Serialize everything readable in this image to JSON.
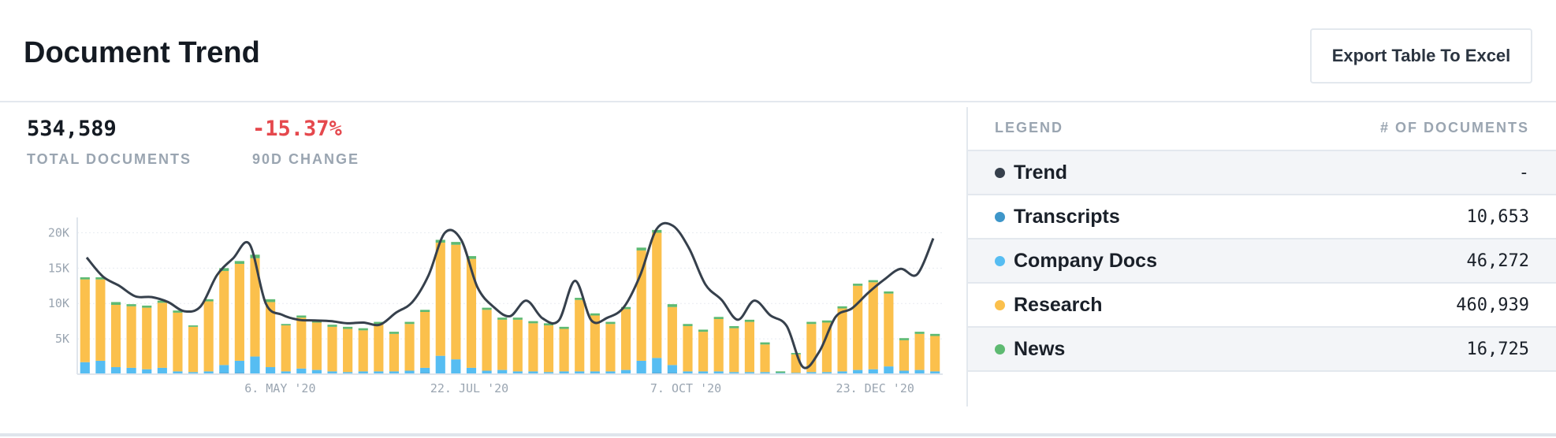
{
  "header": {
    "title": "Document Trend",
    "export_label": "Export Table To Excel"
  },
  "stats": {
    "total_value": "534,589",
    "total_label": "TOTAL DOCUMENTS",
    "change_value": "-15.37%",
    "change_label": "90D CHANGE"
  },
  "colors": {
    "trend": "#36404c",
    "transcripts": "#3e96c9",
    "company_docs": "#56bdf2",
    "research": "#fbc04c",
    "news": "#5eba72",
    "change_negative": "#e5484d"
  },
  "legend": {
    "header_left": "LEGEND",
    "header_right": "# OF DOCUMENTS",
    "rows": [
      {
        "name": "Trend",
        "count": "-"
      },
      {
        "name": "Transcripts",
        "count": "10,653"
      },
      {
        "name": "Company Docs",
        "count": "46,272"
      },
      {
        "name": "Research",
        "count": "460,939"
      },
      {
        "name": "News",
        "count": "16,725"
      }
    ]
  },
  "chart_data": {
    "type": "bar",
    "stacked": true,
    "yticks": [
      "20K",
      "15K",
      "10K",
      "5K"
    ],
    "ytick_values": [
      20000,
      15000,
      10000,
      5000
    ],
    "ylim": [
      0,
      21500
    ],
    "xtick_labels": [
      "6. MAY '20",
      "22. JUL '20",
      "7. OCT '20",
      "23. DEC '20"
    ],
    "xtick_index": [
      7.5,
      14.5,
      22.5,
      29.5
    ],
    "grid": true,
    "series": [
      {
        "name": "Transcripts",
        "values": [
          0,
          0,
          0,
          0,
          0,
          0,
          0,
          0,
          0,
          200,
          200,
          0,
          0,
          0,
          0,
          0,
          0,
          0,
          0,
          0,
          0,
          0,
          200,
          0,
          0,
          0,
          0,
          0,
          0,
          0,
          0,
          0,
          0,
          0,
          0,
          0,
          0,
          200,
          200,
          0,
          0,
          0,
          0,
          0,
          0,
          0,
          0,
          0,
          0,
          0,
          0,
          0,
          0,
          0,
          0,
          0,
          0,
          0,
          0,
          0,
          0,
          0,
          0,
          0,
          0,
          0,
          0,
          0,
          0,
          0
        ]
      },
      {
        "name": "Company Docs",
        "values": [
          1700,
          1900,
          1000,
          900,
          700,
          900,
          400,
          300,
          400,
          1100,
          1700,
          2500,
          1000,
          400,
          800,
          600,
          400,
          300,
          400,
          400,
          400,
          500,
          700,
          2600,
          2100,
          900,
          500,
          600,
          400,
          400,
          300,
          400,
          400,
          400,
          400,
          600,
          1900,
          2100,
          1100,
          400,
          400,
          400,
          300,
          300,
          300,
          200,
          200,
          300,
          300,
          400,
          600,
          700,
          1100,
          500,
          600,
          400
        ]
      },
      {
        "name": "Research",
        "values": [
          11700,
          11500,
          8800,
          8700,
          8700,
          9200,
          8300,
          6400,
          9900,
          13300,
          13700,
          13900,
          9200,
          6500,
          7200,
          6700,
          6300,
          6100,
          5800,
          6600,
          5300,
          6600,
          7900,
          16000,
          16200,
          15400,
          8600,
          7100,
          7300,
          6800,
          6600,
          6000,
          10100,
          7900,
          6700,
          8600,
          15600,
          17700,
          8200,
          6400,
          5600,
          7400,
          6200,
          7100,
          3900,
          0,
          2600,
          6800,
          7000,
          8900,
          11900,
          12300,
          10300,
          4300,
          5100,
          5000
        ]
      },
      {
        "name": "News",
        "values": [
          300,
          300,
          400,
          300,
          300,
          300,
          300,
          200,
          300,
          400,
          400,
          500,
          400,
          200,
          300,
          300,
          300,
          300,
          300,
          400,
          300,
          300,
          300,
          400,
          400,
          400,
          300,
          300,
          300,
          300,
          300,
          300,
          300,
          300,
          300,
          300,
          400,
          400,
          400,
          300,
          300,
          300,
          300,
          300,
          300,
          200,
          200,
          300,
          300,
          300,
          300,
          300,
          300,
          300,
          300,
          300
        ]
      }
    ],
    "trend": [
      16500,
      13800,
      12500,
      11000,
      10900,
      10200,
      8900,
      9600,
      14000,
      16400,
      18400,
      10000,
      8400,
      7700,
      7600,
      7500,
      7200,
      7300,
      7000,
      8700,
      10200,
      14000,
      20000,
      19000,
      12300,
      9500,
      8200,
      10400,
      7900,
      7600,
      13200,
      7600,
      8000,
      9500,
      14000,
      20500,
      21000,
      17800,
      12700,
      10500,
      7700,
      10400,
      8300,
      6800,
      1000,
      3200,
      8100,
      9300,
      11500,
      13400,
      14900,
      14100,
      19200
    ]
  }
}
